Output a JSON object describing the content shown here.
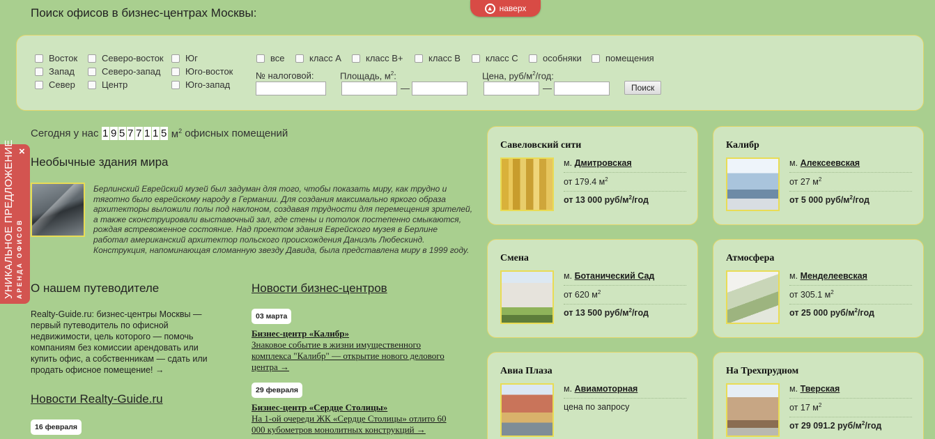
{
  "top_button": {
    "label": "наверх"
  },
  "search": {
    "title": "Поиск офисов в бизнес-центрах Москвы:",
    "districts": [
      [
        "Восток",
        "Северо-восток",
        "Юг"
      ],
      [
        "Запад",
        "Северо-запад",
        "Юго-восток"
      ],
      [
        "Север",
        "Центр",
        "Юго-запад"
      ]
    ],
    "classes": [
      "все",
      "класс А",
      "класс В+",
      "класс В",
      "класс С",
      "особняки",
      "помещения"
    ],
    "tax_label": "№ налоговой:",
    "area_label": "Площадь,  м",
    "price_label": "Цена,  руб/м",
    "price_label_suffix": "/год:",
    "dash": "—",
    "button": "Поиск"
  },
  "stats": {
    "prefix": "Сегодня у нас",
    "digits": [
      "1",
      "9",
      "5",
      "7",
      "7",
      "1",
      "1",
      "5"
    ],
    "unit": "м",
    "suffix": "офисных помещений"
  },
  "unusual": {
    "heading": "Необычные здания мира",
    "text": "Берлинский Еврейский музей был задуман для того, чтобы показать миру, как трудно и тяготно было еврейскому народу в Германии. Для создания максимально яркого образа архитекторы выложили полы под наклоном, создавая трудности для перемещения зрителей, а также сконструировали выставочный зал, где стены и потолок постепенно смыкаются, рождая встревоженное состояние. Над проектом здания Еврейского музея в Берлине работал американский архитектор польского происхождения Даниэль Любескинд. Конструкция, напоминающая сломанную звезду Давида, была представлена миру в 1999 году."
  },
  "about": {
    "heading": "О нашем путеводителе",
    "text": "Realty-Guide.ru: бизнес-центры Москвы — первый путеводитель по офисной недвижимости, цель которого — помочь компаниям без комиссии арендовать или купить офис, а собственникам — сдать или продать офисное помещение!  →"
  },
  "site_news": {
    "heading": "Новости Realty-Guide.ru",
    "date": "16 февраля"
  },
  "bc_news": {
    "heading": "Новости бизнес-центров",
    "items": [
      {
        "date": "03 марта",
        "title": "Бизнес-центр «Калибр»",
        "body": "Знаковое событие в жизни имущественного комплекса \"Калибр\" — открытие нового делового центра →"
      },
      {
        "date": "29 февраля",
        "title": "Бизнес-центр «Сердце Столицы»",
        "body": "На 1-ой очереди ЖК «Сердце Столицы» отлито 60 000 кубометров монолитных конструкций →"
      }
    ]
  },
  "side_offer": {
    "line1": "УНИКАЛЬНОЕ ПРЕДЛОЖЕНИЕ",
    "line2": "АРЕНДА ОФИСОВ",
    "close": "×"
  },
  "offices": [
    {
      "name": "Савеловский сити",
      "metro_prefix": "м.",
      "metro": "Дмитровская",
      "area": "от 179.4 м",
      "price": "от 13 000 руб/м",
      "price_suffix": "/год",
      "img": "tower-yellow"
    },
    {
      "name": "Калибр",
      "metro_prefix": "м.",
      "metro": "Алексеевская",
      "area": "от 27 м",
      "price": "от 5 000 руб/м",
      "price_suffix": "/год",
      "img": "glass-building"
    },
    {
      "name": "Смена",
      "metro_prefix": "м.",
      "metro": "Ботанический Сад",
      "area": "от 620 м",
      "price": "от 13 500 руб/м",
      "price_suffix": "/год",
      "img": "white-block"
    },
    {
      "name": "Атмосфера",
      "metro_prefix": "м.",
      "metro": "Менделеевская",
      "area": "от 305.1 м",
      "price": "от 25 000 руб/м",
      "price_suffix": "/год",
      "img": "aerial-complex"
    },
    {
      "name": "Авиа Плаза",
      "metro_prefix": "м.",
      "metro": "Авиамоторная",
      "area": "цена по запросу",
      "price": "",
      "price_suffix": "",
      "img": "red-tower"
    },
    {
      "name": "На Трехпрудном",
      "metro_prefix": "м.",
      "metro": "Тверская",
      "area": "от 17 м",
      "price": "от 29 091.2 руб/м",
      "price_suffix": "/год",
      "img": "historic-building"
    }
  ]
}
